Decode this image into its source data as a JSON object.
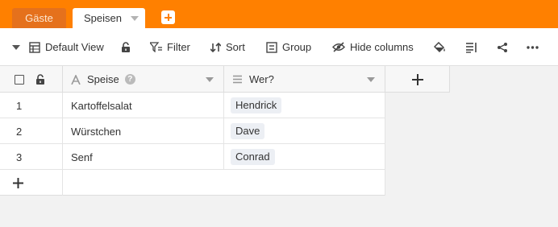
{
  "tabs": [
    {
      "label": "Gäste",
      "active": false
    },
    {
      "label": "Speisen",
      "active": true
    }
  ],
  "toolbar": {
    "view_label": "Default View",
    "filter_label": "Filter",
    "sort_label": "Sort",
    "group_label": "Group",
    "hide_columns_label": "Hide columns"
  },
  "table": {
    "columns": [
      {
        "name": "Speise",
        "type": "text"
      },
      {
        "name": "Wer?",
        "type": "single-select"
      }
    ],
    "rows": [
      {
        "num": "1",
        "speise": "Kartoffelsalat",
        "wer": "Hendrick"
      },
      {
        "num": "2",
        "speise": "Würstchen",
        "wer": "Dave"
      },
      {
        "num": "3",
        "speise": "Senf",
        "wer": "Conrad"
      }
    ]
  },
  "colors": {
    "accent": "#ff8000",
    "tag_bg": "#eceff4"
  }
}
